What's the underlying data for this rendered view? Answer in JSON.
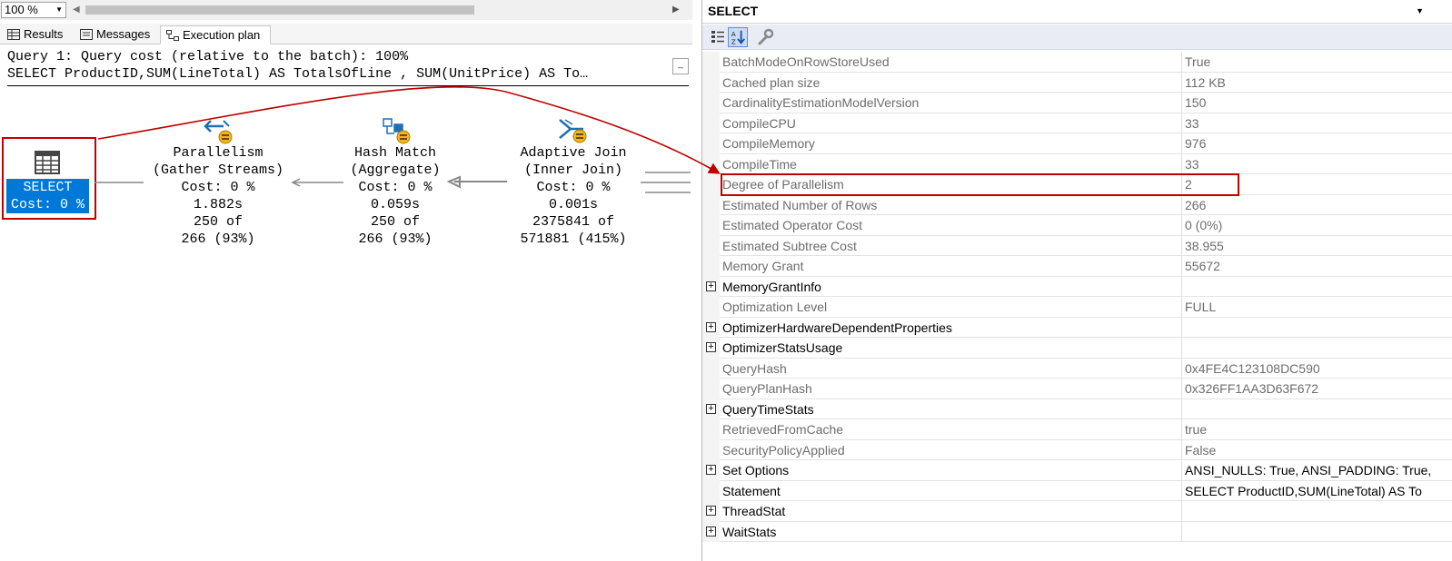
{
  "zoom": {
    "value": "100 %"
  },
  "tabs": [
    {
      "label": "Results",
      "icon": "grid-icon"
    },
    {
      "label": "Messages",
      "icon": "messages-icon"
    },
    {
      "label": "Execution plan",
      "icon": "execution-plan-icon"
    }
  ],
  "query": {
    "line1": "Query 1: Query cost (relative to the batch): 100%",
    "line2": "SELECT ProductID,SUM(LineTotal) AS TotalsOfLine , SUM(UnitPrice) AS To…"
  },
  "plan": {
    "select": {
      "line1": "SELECT",
      "line2": "Cost: 0 %"
    },
    "parallelism": {
      "label": "Parallelism\n(Gather Streams)\nCost: 0 %\n1.882s\n250 of\n266 (93%)"
    },
    "hash_match": {
      "label": "Hash Match\n(Aggregate)\nCost: 0 %\n0.059s\n250 of\n266 (93%)"
    },
    "adaptive_join": {
      "label": "Adaptive Join\n(Inner Join)\nCost: 0 %\n0.001s\n2375841 of\n571881 (415%)"
    }
  },
  "properties": {
    "object": "SELECT",
    "rows": [
      {
        "name": "BatchModeOnRowStoreUsed",
        "value": "True",
        "expandable": false,
        "strong": false
      },
      {
        "name": "Cached plan size",
        "value": "112 KB",
        "expandable": false,
        "strong": false
      },
      {
        "name": "CardinalityEstimationModelVersion",
        "value": "150",
        "expandable": false,
        "strong": false
      },
      {
        "name": "CompileCPU",
        "value": "33",
        "expandable": false,
        "strong": false
      },
      {
        "name": "CompileMemory",
        "value": "976",
        "expandable": false,
        "strong": false
      },
      {
        "name": "CompileTime",
        "value": "33",
        "expandable": false,
        "strong": false
      },
      {
        "name": "Degree of Parallelism",
        "value": "2",
        "expandable": false,
        "strong": false
      },
      {
        "name": "Estimated Number of Rows",
        "value": "266",
        "expandable": false,
        "strong": false
      },
      {
        "name": "Estimated Operator Cost",
        "value": "0 (0%)",
        "expandable": false,
        "strong": false
      },
      {
        "name": "Estimated Subtree Cost",
        "value": "38.955",
        "expandable": false,
        "strong": false
      },
      {
        "name": "Memory Grant",
        "value": "55672",
        "expandable": false,
        "strong": false
      },
      {
        "name": "MemoryGrantInfo",
        "value": "",
        "expandable": true,
        "strong": true
      },
      {
        "name": "Optimization Level",
        "value": "FULL",
        "expandable": false,
        "strong": false
      },
      {
        "name": "OptimizerHardwareDependentProperties",
        "value": "",
        "expandable": true,
        "strong": true
      },
      {
        "name": "OptimizerStatsUsage",
        "value": "",
        "expandable": true,
        "strong": true
      },
      {
        "name": "QueryHash",
        "value": "0x4FE4C123108DC590",
        "expandable": false,
        "strong": false
      },
      {
        "name": "QueryPlanHash",
        "value": "0x326FF1AA3D63F672",
        "expandable": false,
        "strong": false
      },
      {
        "name": "QueryTimeStats",
        "value": "",
        "expandable": true,
        "strong": true
      },
      {
        "name": "RetrievedFromCache",
        "value": "true",
        "expandable": false,
        "strong": false
      },
      {
        "name": "SecurityPolicyApplied",
        "value": "False",
        "expandable": false,
        "strong": false
      },
      {
        "name": "Set Options",
        "value": "ANSI_NULLS: True, ANSI_PADDING: True,",
        "expandable": true,
        "strong": true
      },
      {
        "name": "Statement",
        "value": "SELECT  ProductID,SUM(LineTotal) AS To",
        "expandable": false,
        "strong": true
      },
      {
        "name": "ThreadStat",
        "value": "",
        "expandable": true,
        "strong": true
      },
      {
        "name": "WaitStats",
        "value": "",
        "expandable": true,
        "strong": true
      }
    ]
  },
  "colors": {
    "highlight": "#c00000",
    "selection": "#0078d7",
    "toolbar": "#e9ecf5"
  }
}
